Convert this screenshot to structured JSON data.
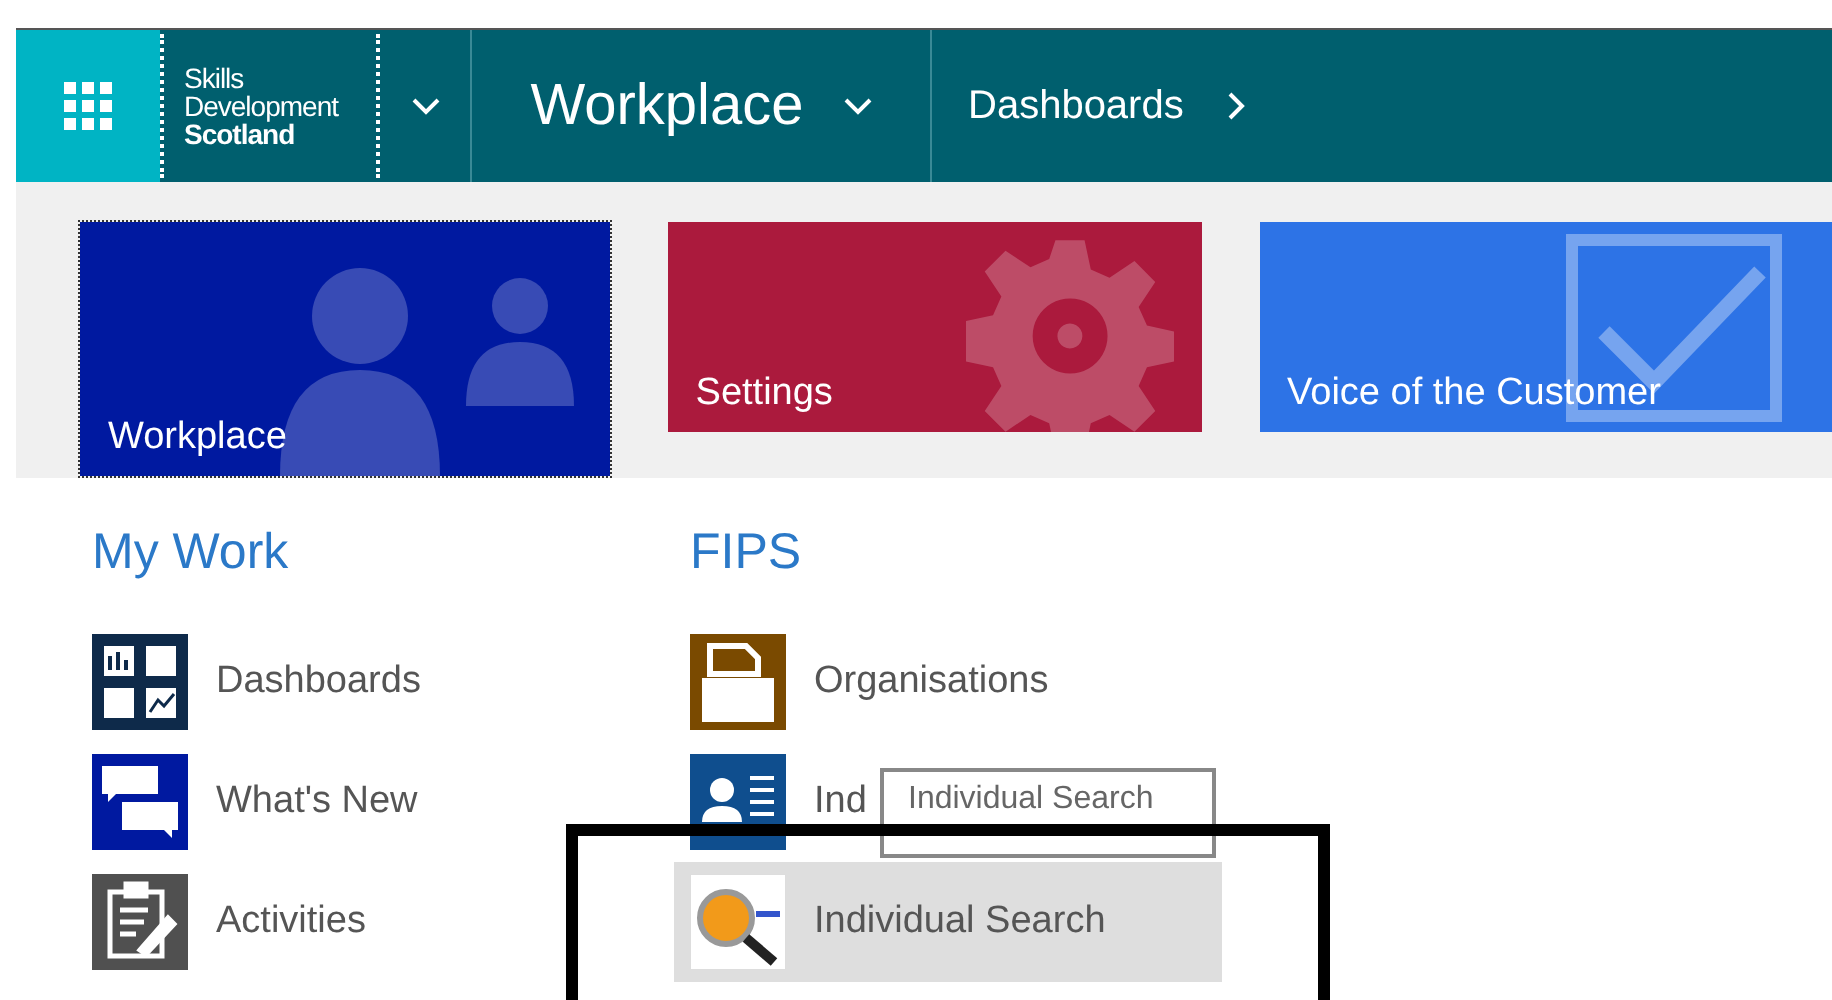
{
  "nav": {
    "logo_lines": [
      "Skills",
      "Development",
      "Scotland"
    ],
    "app": "Workplace",
    "breadcrumb": "Dashboards"
  },
  "tiles": [
    {
      "label": "Workplace",
      "kind": "people",
      "color": "#0019a0",
      "focused": true
    },
    {
      "label": "Settings",
      "kind": "gear",
      "color": "#ab1a3d",
      "focused": false
    },
    {
      "label": "Voice of the Customer",
      "kind": "check",
      "color": "#2d73e6",
      "focused": false
    }
  ],
  "sections": [
    {
      "title": "My Work",
      "items": [
        {
          "label": "Dashboards",
          "kind": "dashboard",
          "selected": false
        },
        {
          "label": "What's New",
          "kind": "chat",
          "selected": false
        },
        {
          "label": "Activities",
          "kind": "clipboard",
          "selected": false
        }
      ]
    },
    {
      "title": "FIPS",
      "items": [
        {
          "label": "Organisations",
          "kind": "folder",
          "selected": false
        },
        {
          "label": "Ind",
          "kind": "contact",
          "selected": false
        },
        {
          "label": "Individual Search",
          "kind": "search",
          "selected": true
        }
      ]
    }
  ],
  "tooltip": {
    "text": "Individual Search"
  }
}
